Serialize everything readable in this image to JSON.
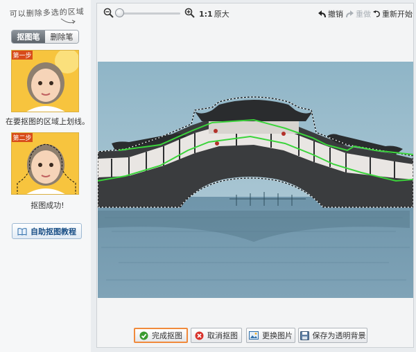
{
  "left_panel": {
    "hint": "可以删除多选的区域",
    "tools": {
      "brush": "抠图笔",
      "eraser": "删除笔"
    },
    "steps": [
      {
        "badge": "第一步",
        "caption": "在要抠图的区域上划线。"
      },
      {
        "badge": "第二步",
        "caption": "抠图成功!"
      }
    ],
    "tutorial_button": "自助抠图教程"
  },
  "toolbar": {
    "zoom_ratio": "1:1",
    "actual_size": "原大",
    "undo": "撤销",
    "redo": "重做",
    "restart": "重新开始"
  },
  "bottom_bar": {
    "done": "完成抠图",
    "cancel": "取消抠图",
    "replace": "更换图片",
    "save_transparent": "保存为透明背景"
  },
  "colors": {
    "accent_orange": "#f08a3c",
    "stroke_green": "#3bd43b",
    "link_blue": "#1a4f86"
  }
}
